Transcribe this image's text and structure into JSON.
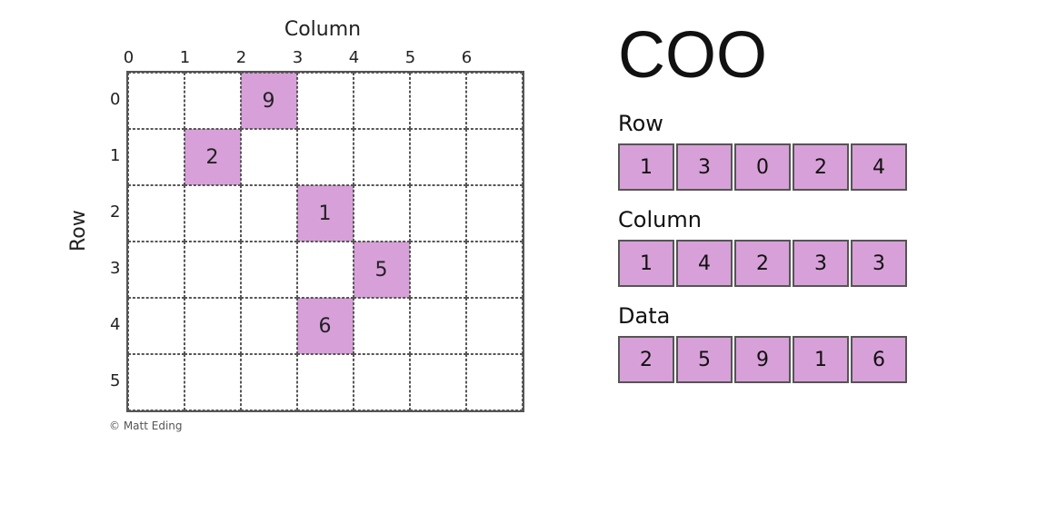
{
  "title": "COO",
  "matrix": {
    "col_label": "Column",
    "row_label": "Row",
    "col_indices": [
      0,
      1,
      2,
      3,
      4,
      5,
      6
    ],
    "row_indices": [
      0,
      1,
      2,
      3,
      4,
      5
    ],
    "highlighted_cells": [
      {
        "row": 0,
        "col": 2,
        "value": 9
      },
      {
        "row": 1,
        "col": 1,
        "value": 2
      },
      {
        "row": 2,
        "col": 3,
        "value": 1
      },
      {
        "row": 3,
        "col": 4,
        "value": 5
      },
      {
        "row": 4,
        "col": 3,
        "value": 6
      }
    ]
  },
  "arrays": {
    "row_label": "Row",
    "row_values": [
      1,
      3,
      0,
      2,
      4
    ],
    "col_label": "Column",
    "col_values": [
      1,
      4,
      2,
      3,
      3
    ],
    "data_label": "Data",
    "data_values": [
      2,
      5,
      9,
      1,
      6
    ]
  },
  "copyright": "© Matt Eding"
}
